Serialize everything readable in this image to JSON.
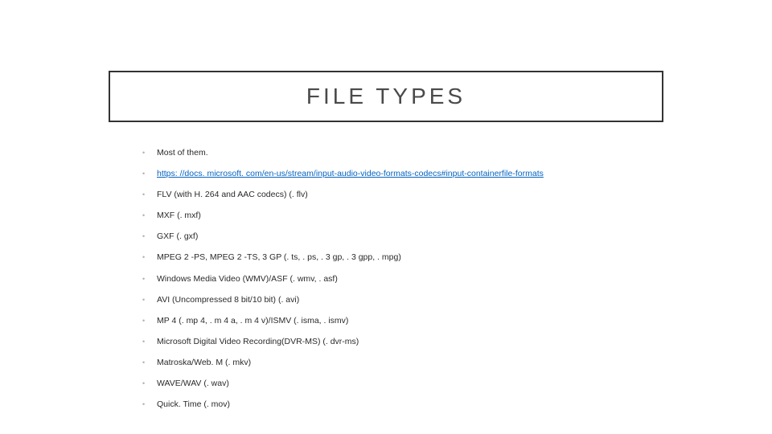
{
  "title": "FILE TYPES",
  "bullets": [
    {
      "text": "Most of them.",
      "link": false
    },
    {
      "text": "https: //docs. microsoft. com/en-us/stream/input-audio-video-formats-codecs#input-containerfile-formats",
      "link": true
    },
    {
      "text": "FLV (with H. 264 and AAC codecs) (. flv)",
      "link": false
    },
    {
      "text": "MXF (. mxf)",
      "link": false
    },
    {
      "text": "GXF (. gxf)",
      "link": false
    },
    {
      "text": "MPEG 2 -PS, MPEG 2 -TS, 3 GP (. ts, . ps, . 3 gp, . 3 gpp, . mpg)",
      "link": false
    },
    {
      "text": "Windows Media Video (WMV)/ASF (. wmv, . asf)",
      "link": false
    },
    {
      "text": "AVI (Uncompressed 8 bit/10 bit) (. avi)",
      "link": false
    },
    {
      "text": "MP 4 (. mp 4, . m 4 a, . m 4 v)/ISMV (. isma, . ismv)",
      "link": false
    },
    {
      "text": "Microsoft Digital Video Recording(DVR-MS) (. dvr-ms)",
      "link": false
    },
    {
      "text": "Matroska/Web. M (. mkv)",
      "link": false
    },
    {
      "text": "WAVE/WAV (. wav)",
      "link": false
    },
    {
      "text": "Quick. Time (. mov)",
      "link": false
    }
  ]
}
